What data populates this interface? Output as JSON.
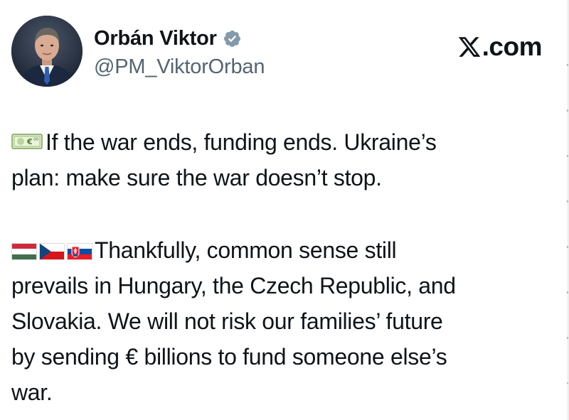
{
  "post": {
    "author": {
      "display_name": "Orbán Viktor",
      "handle": "@PM_ViktorOrban",
      "verified_icon": "verified-badge-icon"
    },
    "brand": {
      "logo": "X",
      "suffix": ".com"
    },
    "paragraph1": {
      "emoji": "euro-banknote-icon",
      "line1": "If the war ends, funding ends. Ukraine’s",
      "line2": "plan: make sure the war doesn’t stop."
    },
    "paragraph2": {
      "emojis": [
        "hungary-flag-icon",
        "czech-flag-icon",
        "slovakia-flag-icon"
      ],
      "line1": "Thankfully, common sense still",
      "line2": "prevails in Hungary, the Czech Republic, and",
      "line3": "Slovakia. We will not risk our families’ future",
      "line4": "by sending € billions to fund someone else’s",
      "line5": "war."
    }
  }
}
